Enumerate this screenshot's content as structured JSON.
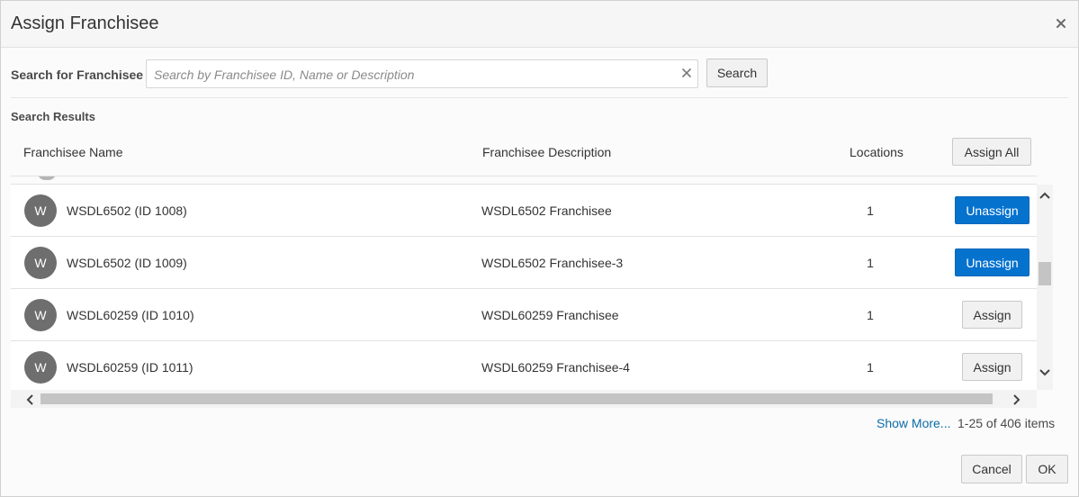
{
  "dialog": {
    "title": "Assign Franchisee"
  },
  "search": {
    "label": "Search for Franchisee",
    "placeholder": "Search by Franchisee ID, Name or Description",
    "value": "",
    "button_label": "Search"
  },
  "results": {
    "label": "Search Results",
    "columns": {
      "name": "Franchisee Name",
      "description": "Franchisee Description",
      "locations": "Locations"
    },
    "assign_all_label": "Assign All",
    "rows": [
      {
        "avatar": "W",
        "name": "WSDL6502 (ID 1008)",
        "description": "WSDL6502 Franchisee",
        "locations": "1",
        "action": "Unassign",
        "assigned": true
      },
      {
        "avatar": "W",
        "name": "WSDL6502  (ID 1009)",
        "description": "WSDL6502  Franchisee-3",
        "locations": "1",
        "action": "Unassign",
        "assigned": true
      },
      {
        "avatar": "W",
        "name": "WSDL60259  (ID 1010)",
        "description": "WSDL60259 Franchisee",
        "locations": "1",
        "action": "Assign",
        "assigned": false
      },
      {
        "avatar": "W",
        "name": "WSDL60259  (ID 1011)",
        "description": "WSDL60259 Franchisee-4",
        "locations": "1",
        "action": "Assign",
        "assigned": false
      }
    ]
  },
  "pagination": {
    "show_more": "Show More...",
    "count": "1-25 of 406 items"
  },
  "footer": {
    "cancel_label": "Cancel",
    "ok_label": "OK"
  },
  "colors": {
    "primary": "#0572ce",
    "avatar": "#6e6e6e",
    "link": "#0b6ca8"
  },
  "icons": {
    "close": "close-icon",
    "clear": "clear-icon",
    "scroll_up": "chevron-up-icon",
    "scroll_down": "chevron-down-icon",
    "scroll_left": "chevron-left-icon",
    "scroll_right": "chevron-right-icon"
  }
}
